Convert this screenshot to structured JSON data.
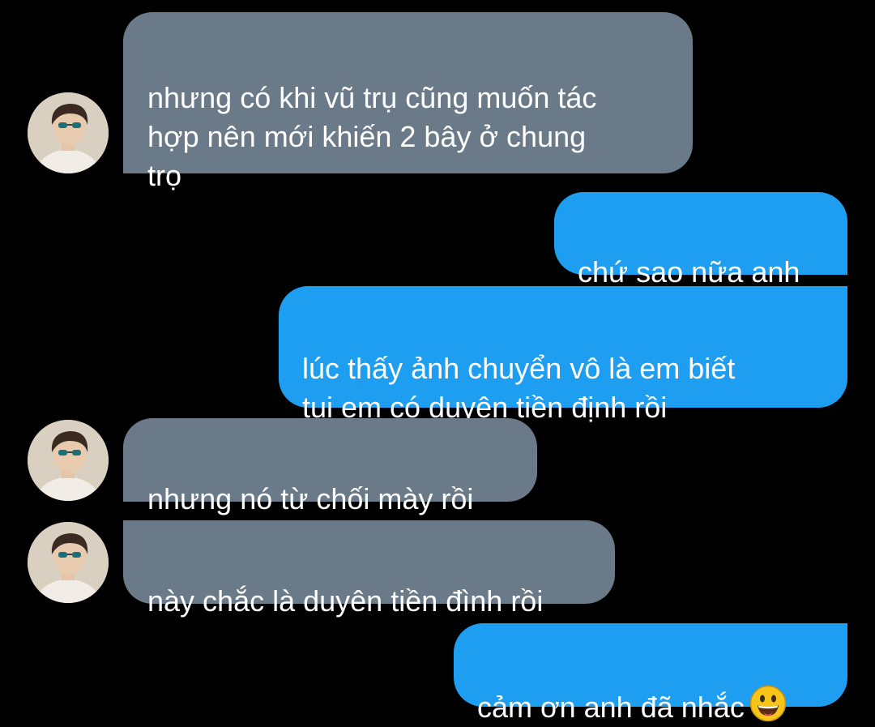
{
  "colors": {
    "background": "#000000",
    "incoming_bubble": "#6a7a88",
    "outgoing_bubble": "#1e9ef0",
    "text": "#ffffff"
  },
  "messages": [
    {
      "direction": "incoming",
      "text": "nhưng có khi vũ trụ cũng muốn tác\nhợp nên mới khiến 2 bây ở chung\ntrọ"
    },
    {
      "direction": "outgoing",
      "text": "chứ sao nữa anh"
    },
    {
      "direction": "outgoing",
      "text": "lúc thấy ảnh chuyển vô là em biết\ntụi em có duyên tiền định rồi"
    },
    {
      "direction": "incoming",
      "text": "nhưng nó từ chối mày rồi"
    },
    {
      "direction": "incoming",
      "text": "này chắc là duyên tiền đình rồi"
    },
    {
      "direction": "outgoing",
      "text": "cảm ơn anh đã nhắc",
      "emoji": "grinning-face-with-tongue-emoji"
    }
  ]
}
